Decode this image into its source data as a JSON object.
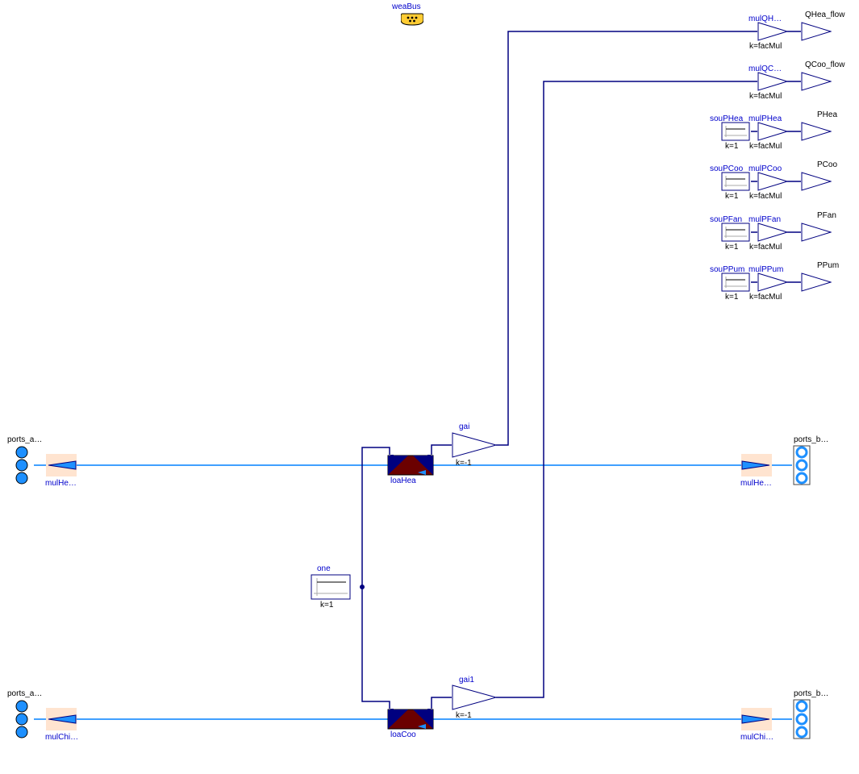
{
  "weaBus": {
    "label": "weaBus"
  },
  "outputs": {
    "QHea_flow": {
      "gain_name": "mulQH…",
      "gain_k": "k=facMul",
      "out_label": "QHea_flow"
    },
    "QCoo_flow": {
      "gain_name": "mulQC…",
      "gain_k": "k=facMul",
      "out_label": "QCoo_flow"
    },
    "PHea": {
      "src_name": "souPHea",
      "src_k": "k=1",
      "gain_name": "mulPHea",
      "gain_k": "k=facMul",
      "out_label": "PHea"
    },
    "PCoo": {
      "src_name": "souPCoo",
      "src_k": "k=1",
      "gain_name": "mulPCoo",
      "gain_k": "k=facMul",
      "out_label": "PCoo"
    },
    "PFan": {
      "src_name": "souPFan",
      "src_k": "k=1",
      "gain_name": "mulPFan",
      "gain_k": "k=facMul",
      "out_label": "PFan"
    },
    "PPum": {
      "src_name": "souPPum",
      "src_k": "k=1",
      "gain_name": "mulPPum",
      "gain_k": "k=facMul",
      "out_label": "PPum"
    }
  },
  "heating": {
    "ports_a": "ports_a…",
    "mulIn": "mulHe…",
    "load": "loaHea",
    "gain": "gai",
    "gain_k": "k=-1",
    "mulOut": "mulHe…",
    "ports_b": "ports_b…"
  },
  "cooling": {
    "ports_a": "ports_a…",
    "mulIn": "mulChi…",
    "load": "loaCoo",
    "gain": "gai1",
    "gain_k": "k=-1",
    "mulOut": "mulChi…",
    "ports_b": "ports_b…"
  },
  "one": {
    "label": "one",
    "k": "k=1"
  }
}
